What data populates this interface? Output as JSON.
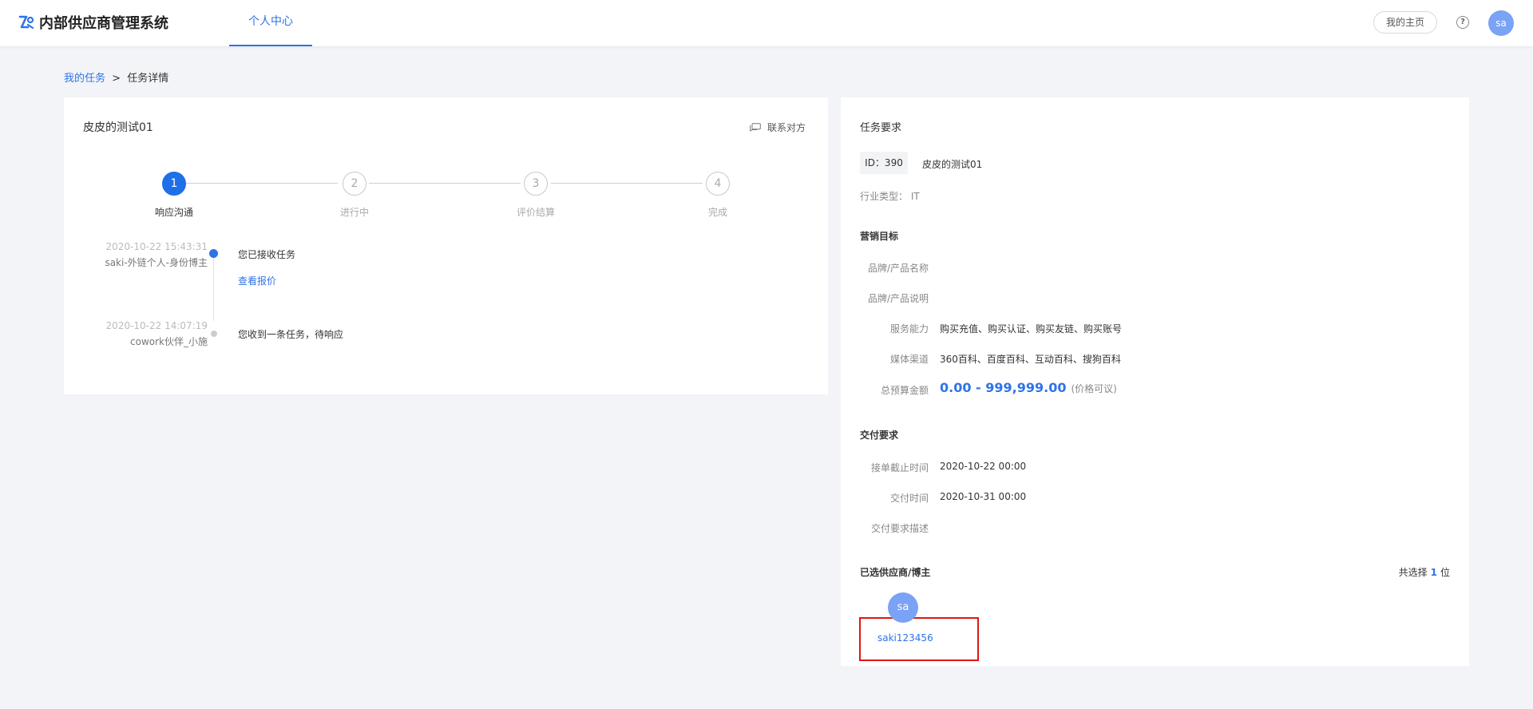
{
  "app": {
    "title": "内部供应商管理系统"
  },
  "header": {
    "nav_tab": "个人中心",
    "homepage_button": "我的主页",
    "help_icon": "question-circle-icon",
    "avatar_text": "sa"
  },
  "breadcrumb": {
    "parent": "我的任务",
    "separator": ">",
    "current": "任务详情"
  },
  "task": {
    "title": "皮皮的测试01",
    "contact_label": "联系对方",
    "steps": [
      {
        "num": "1",
        "label": "响应沟通",
        "state": "active"
      },
      {
        "num": "2",
        "label": "进行中",
        "state": "todo"
      },
      {
        "num": "3",
        "label": "评价结算",
        "state": "todo"
      },
      {
        "num": "4",
        "label": "完成",
        "state": "todo"
      }
    ],
    "timeline": [
      {
        "time": "2020-10-22 15:43:31",
        "who": "saki-外链个人-身份博主",
        "event": "您已接收任务",
        "link": "查看报价",
        "dot_color": "#2f73e6"
      },
      {
        "time": "2020-10-22 14:07:19",
        "who": "cowork伙伴_小施",
        "event": "您收到一条任务，待响应",
        "dot_color": "#cccccc"
      }
    ]
  },
  "requirements": {
    "title": "任务要求",
    "id_badge": "ID：390",
    "id_name": "皮皮的测试01",
    "industry": "行业类型：  IT",
    "marketing": {
      "title": "营销目标",
      "rows": [
        {
          "label": "品牌/产品名称",
          "value": ""
        },
        {
          "label": "品牌/产品说明",
          "value": ""
        },
        {
          "label": "服务能力",
          "value": "购买充值、购买认证、购买友链、购买账号"
        },
        {
          "label": "媒体渠道",
          "value": "360百科、百度百科、互动百科、搜狗百科"
        }
      ],
      "budget_label": "总预算金额",
      "budget_amount": "0.00 - 999,999.00",
      "budget_note": "(价格可议)"
    },
    "delivery": {
      "title": "交付要求",
      "rows": [
        {
          "label": "接单截止时间",
          "value": "2020-10-22 00:00"
        },
        {
          "label": "交付时间",
          "value": "2020-10-31 00:00"
        },
        {
          "label": "交付要求描述",
          "value": ""
        }
      ]
    },
    "suppliers": {
      "title": "已选供应商/博主",
      "count_prefix": "共选择",
      "count": "1",
      "count_suffix": "位",
      "items": [
        {
          "avatar": "sa",
          "name": "saki123456"
        }
      ]
    }
  },
  "colors": {
    "accent": "#2f73e6",
    "highlight_box": "#e01515"
  }
}
